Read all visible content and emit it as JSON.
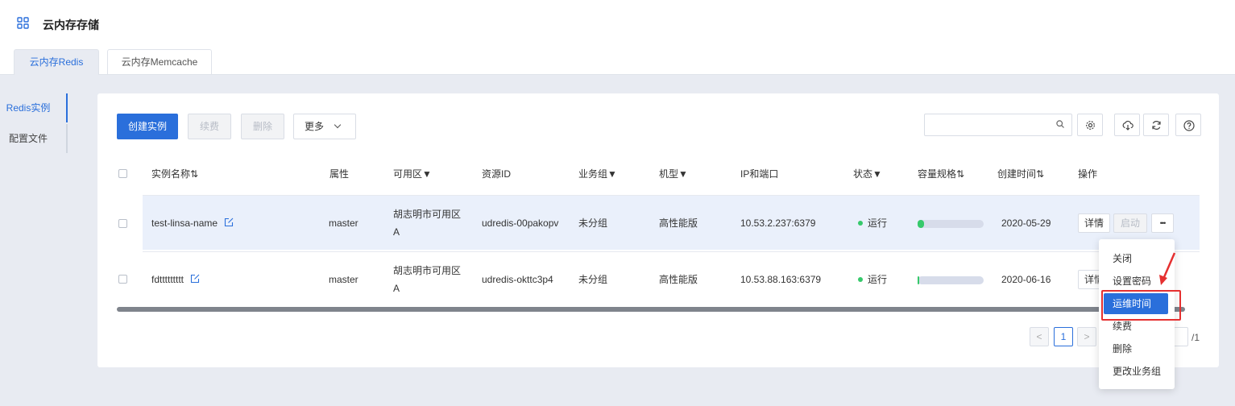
{
  "app": {
    "title": "云内存存储",
    "icon": "grid-icon"
  },
  "tabs": [
    {
      "label": "云内存Redis",
      "active": true
    },
    {
      "label": "云内存Memcache",
      "active": false
    }
  ],
  "sidebar": [
    {
      "label": "Redis实例",
      "active": true
    },
    {
      "label": "配置文件",
      "active": false
    }
  ],
  "toolbar": {
    "create_label": "创建实例",
    "renew_label": "续费",
    "delete_label": "删除",
    "more_label": "更多",
    "search_value": "",
    "icons": [
      "search-icon",
      "gear-icon",
      "cloud-download-icon",
      "refresh-icon",
      "help-icon"
    ]
  },
  "table": {
    "headers": {
      "name": "实例名称⇅",
      "attr": "属性",
      "zone": "可用区▼",
      "resource_id": "资源ID",
      "group": "业务组▼",
      "model": "机型▼",
      "ip": "IP和端口",
      "status": "状态▼",
      "capacity": "容量规格⇅",
      "created": "创建时间⇅",
      "ops": "操作"
    },
    "rows": [
      {
        "name": "test-linsa-name",
        "attr": "master",
        "zone_line1": "胡志明市可用区",
        "zone_line2": "A",
        "resource_id": "udredis-00pakopv",
        "group": "未分组",
        "model": "高性能版",
        "ip": "10.53.2.237:6379",
        "status": "运行",
        "capacity_used": 0.1,
        "created": "2020-05-29",
        "detail_label": "详情",
        "start_label": "启动",
        "more_label": "•••"
      },
      {
        "name": "fdttttttttt",
        "attr": "master",
        "zone_line1": "胡志明市可用区",
        "zone_line2": "A",
        "resource_id": "udredis-okttc3p4",
        "group": "未分组",
        "model": "高性能版",
        "ip": "10.53.88.163:6379",
        "status": "运行",
        "capacity_used": 0.02,
        "created": "2020-06-16",
        "detail_label": "详情"
      }
    ]
  },
  "pagination": {
    "prev": "<",
    "current": "1",
    "next": ">",
    "total": "/1"
  },
  "dropdown_menu": {
    "items": [
      "关闭",
      "设置密码",
      "运维时间",
      "续费",
      "删除",
      "更改业务组"
    ],
    "selected": "运维时间"
  },
  "colors": {
    "accent": "#2a6fdb",
    "status_running": "#36c96b",
    "highlight_box": "#e53030"
  }
}
